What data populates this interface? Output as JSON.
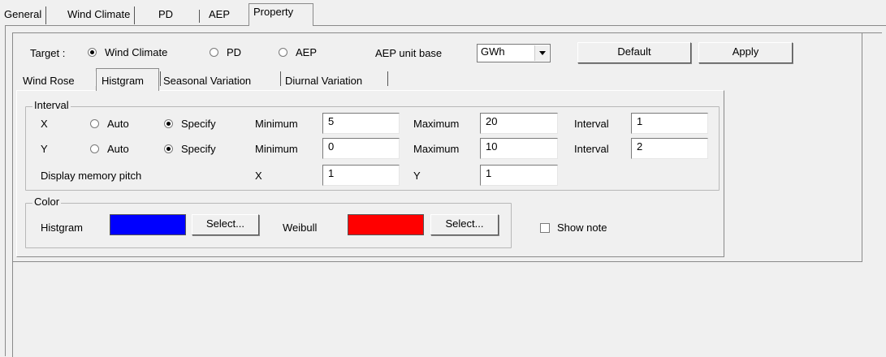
{
  "outer_tabs": [
    "General",
    "Wind Climate",
    "PD",
    "AEP",
    "Property"
  ],
  "target": {
    "label": "Target :",
    "options": [
      "Wind Climate",
      "PD",
      "AEP"
    ],
    "selected": "Wind Climate"
  },
  "aep_unit": {
    "label": "AEP unit base",
    "value": "GWh"
  },
  "buttons": {
    "default": "Default",
    "apply": "Apply"
  },
  "inner_tabs": [
    "Wind Rose",
    "Histgram",
    "Seasonal Variation",
    "Diurnal Variation"
  ],
  "interval": {
    "title": "Interval",
    "rows": [
      {
        "axis": "X",
        "auto": "Auto",
        "specify": "Specify",
        "mode": "Specify",
        "min_label": "Minimum",
        "min": "5",
        "max_label": "Maximum",
        "max": "20",
        "int_label": "Interval",
        "interval": "1"
      },
      {
        "axis": "Y",
        "auto": "Auto",
        "specify": "Specify",
        "mode": "Specify",
        "min_label": "Minimum",
        "min": "0",
        "max_label": "Maximum",
        "max": "10",
        "int_label": "Interval",
        "interval": "2"
      }
    ],
    "pitch": {
      "label": "Display memory pitch",
      "x_label": "X",
      "x": "1",
      "y_label": "Y",
      "y": "1"
    }
  },
  "color": {
    "title": "Color",
    "histgram_label": "Histgram",
    "histgram_color": "#0000ff",
    "weibull_label": "Weibull",
    "weibull_color": "#ff0000",
    "select_label": "Select..."
  },
  "show_note": {
    "label": "Show note",
    "checked": false
  }
}
